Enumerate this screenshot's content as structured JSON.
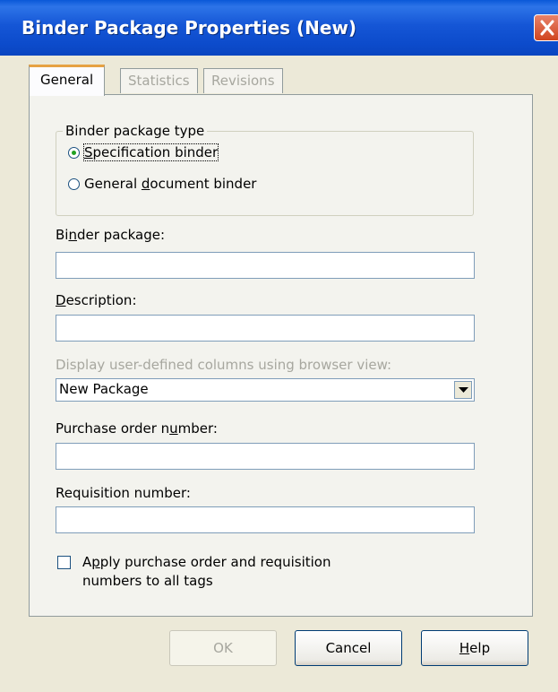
{
  "window": {
    "title": "Binder Package Properties (New)"
  },
  "tabs": [
    {
      "label": "General",
      "active": true
    },
    {
      "label": "Statistics",
      "active": false
    },
    {
      "label": "Revisions",
      "active": false
    }
  ],
  "binder_type": {
    "legend": "Binder package type",
    "options": [
      {
        "pre": "",
        "accel": "S",
        "post": "pecification binder",
        "checked": true
      },
      {
        "pre": "General ",
        "accel": "d",
        "post": "ocument binder",
        "checked": false
      }
    ]
  },
  "fields": {
    "binder_package": {
      "pre": "Bi",
      "accel": "n",
      "post": "der package:",
      "value": ""
    },
    "description": {
      "pre": "",
      "accel": "D",
      "post": "escription:",
      "value": ""
    },
    "browser_view": {
      "label": "Display user-defined columns using browser view:",
      "value": "New Package"
    },
    "purchase_order": {
      "pre": "Purchase order n",
      "accel": "u",
      "post": "mber:",
      "value": ""
    },
    "requisition": {
      "pre": "Requisition number:",
      "value": ""
    }
  },
  "apply_checkbox": {
    "pre": "A",
    "accel": "p",
    "post": "ply purchase order and requisition",
    "line2": "numbers to all tags",
    "checked": false
  },
  "buttons": {
    "ok": "OK",
    "cancel": "Cancel",
    "help": {
      "accel": "H",
      "post": "elp"
    }
  },
  "colors": {
    "titlebar": "#0a58d8",
    "active_tab_accent": "#e6a243",
    "dialog_bg": "#ece9d8"
  }
}
